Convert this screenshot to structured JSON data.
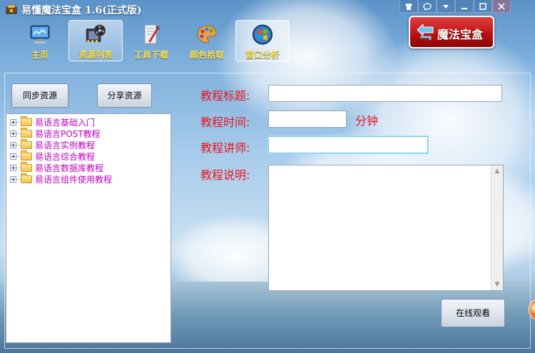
{
  "app": {
    "title": "易懂魔法宝盒 1.6(正式版)"
  },
  "window_controls": [
    {
      "name": "skin-icon",
      "glyph": "👕"
    },
    {
      "name": "feedback-icon",
      "glyph": "✉"
    },
    {
      "name": "menu-icon",
      "glyph": "▾"
    },
    {
      "name": "minimize-icon",
      "glyph": "—"
    },
    {
      "name": "maximize-icon",
      "glyph": "□"
    },
    {
      "name": "close-icon",
      "glyph": "✕"
    }
  ],
  "toolbar": {
    "items": [
      {
        "label": "主页",
        "icon": "monitor-icon",
        "active": false
      },
      {
        "label": "资源列表",
        "icon": "film-reel-icon",
        "active": true
      },
      {
        "label": "工具下载",
        "icon": "tools-icon",
        "active": false
      },
      {
        "label": "颜色拾取",
        "icon": "palette-icon",
        "active": false
      },
      {
        "label": "窗口分析",
        "icon": "windows-orb-icon",
        "active": true
      }
    ]
  },
  "brand": {
    "label": "魔法宝盒"
  },
  "actions": {
    "sync_label": "同步资源",
    "share_label": "分享资源",
    "watch_label": "在线观看"
  },
  "tree": {
    "items": [
      "易语言基础入门",
      "易语言POST教程",
      "易语言实例教程",
      "易语言综合教程",
      "易语言数据库教程",
      "易语言组件使用教程"
    ]
  },
  "form": {
    "title_label": "教程标题:",
    "title_value": "",
    "time_label": "教程时间:",
    "time_value": "",
    "time_unit": "分钟",
    "lecturer_label": "教程讲师:",
    "lecturer_value": "",
    "desc_label": "教程说明:",
    "desc_value": ""
  },
  "colors": {
    "label_red": "#e8151f",
    "tree_text": "#c000c0",
    "toolbar_text": "#ffe34a",
    "brand_red": "#b80f10"
  }
}
